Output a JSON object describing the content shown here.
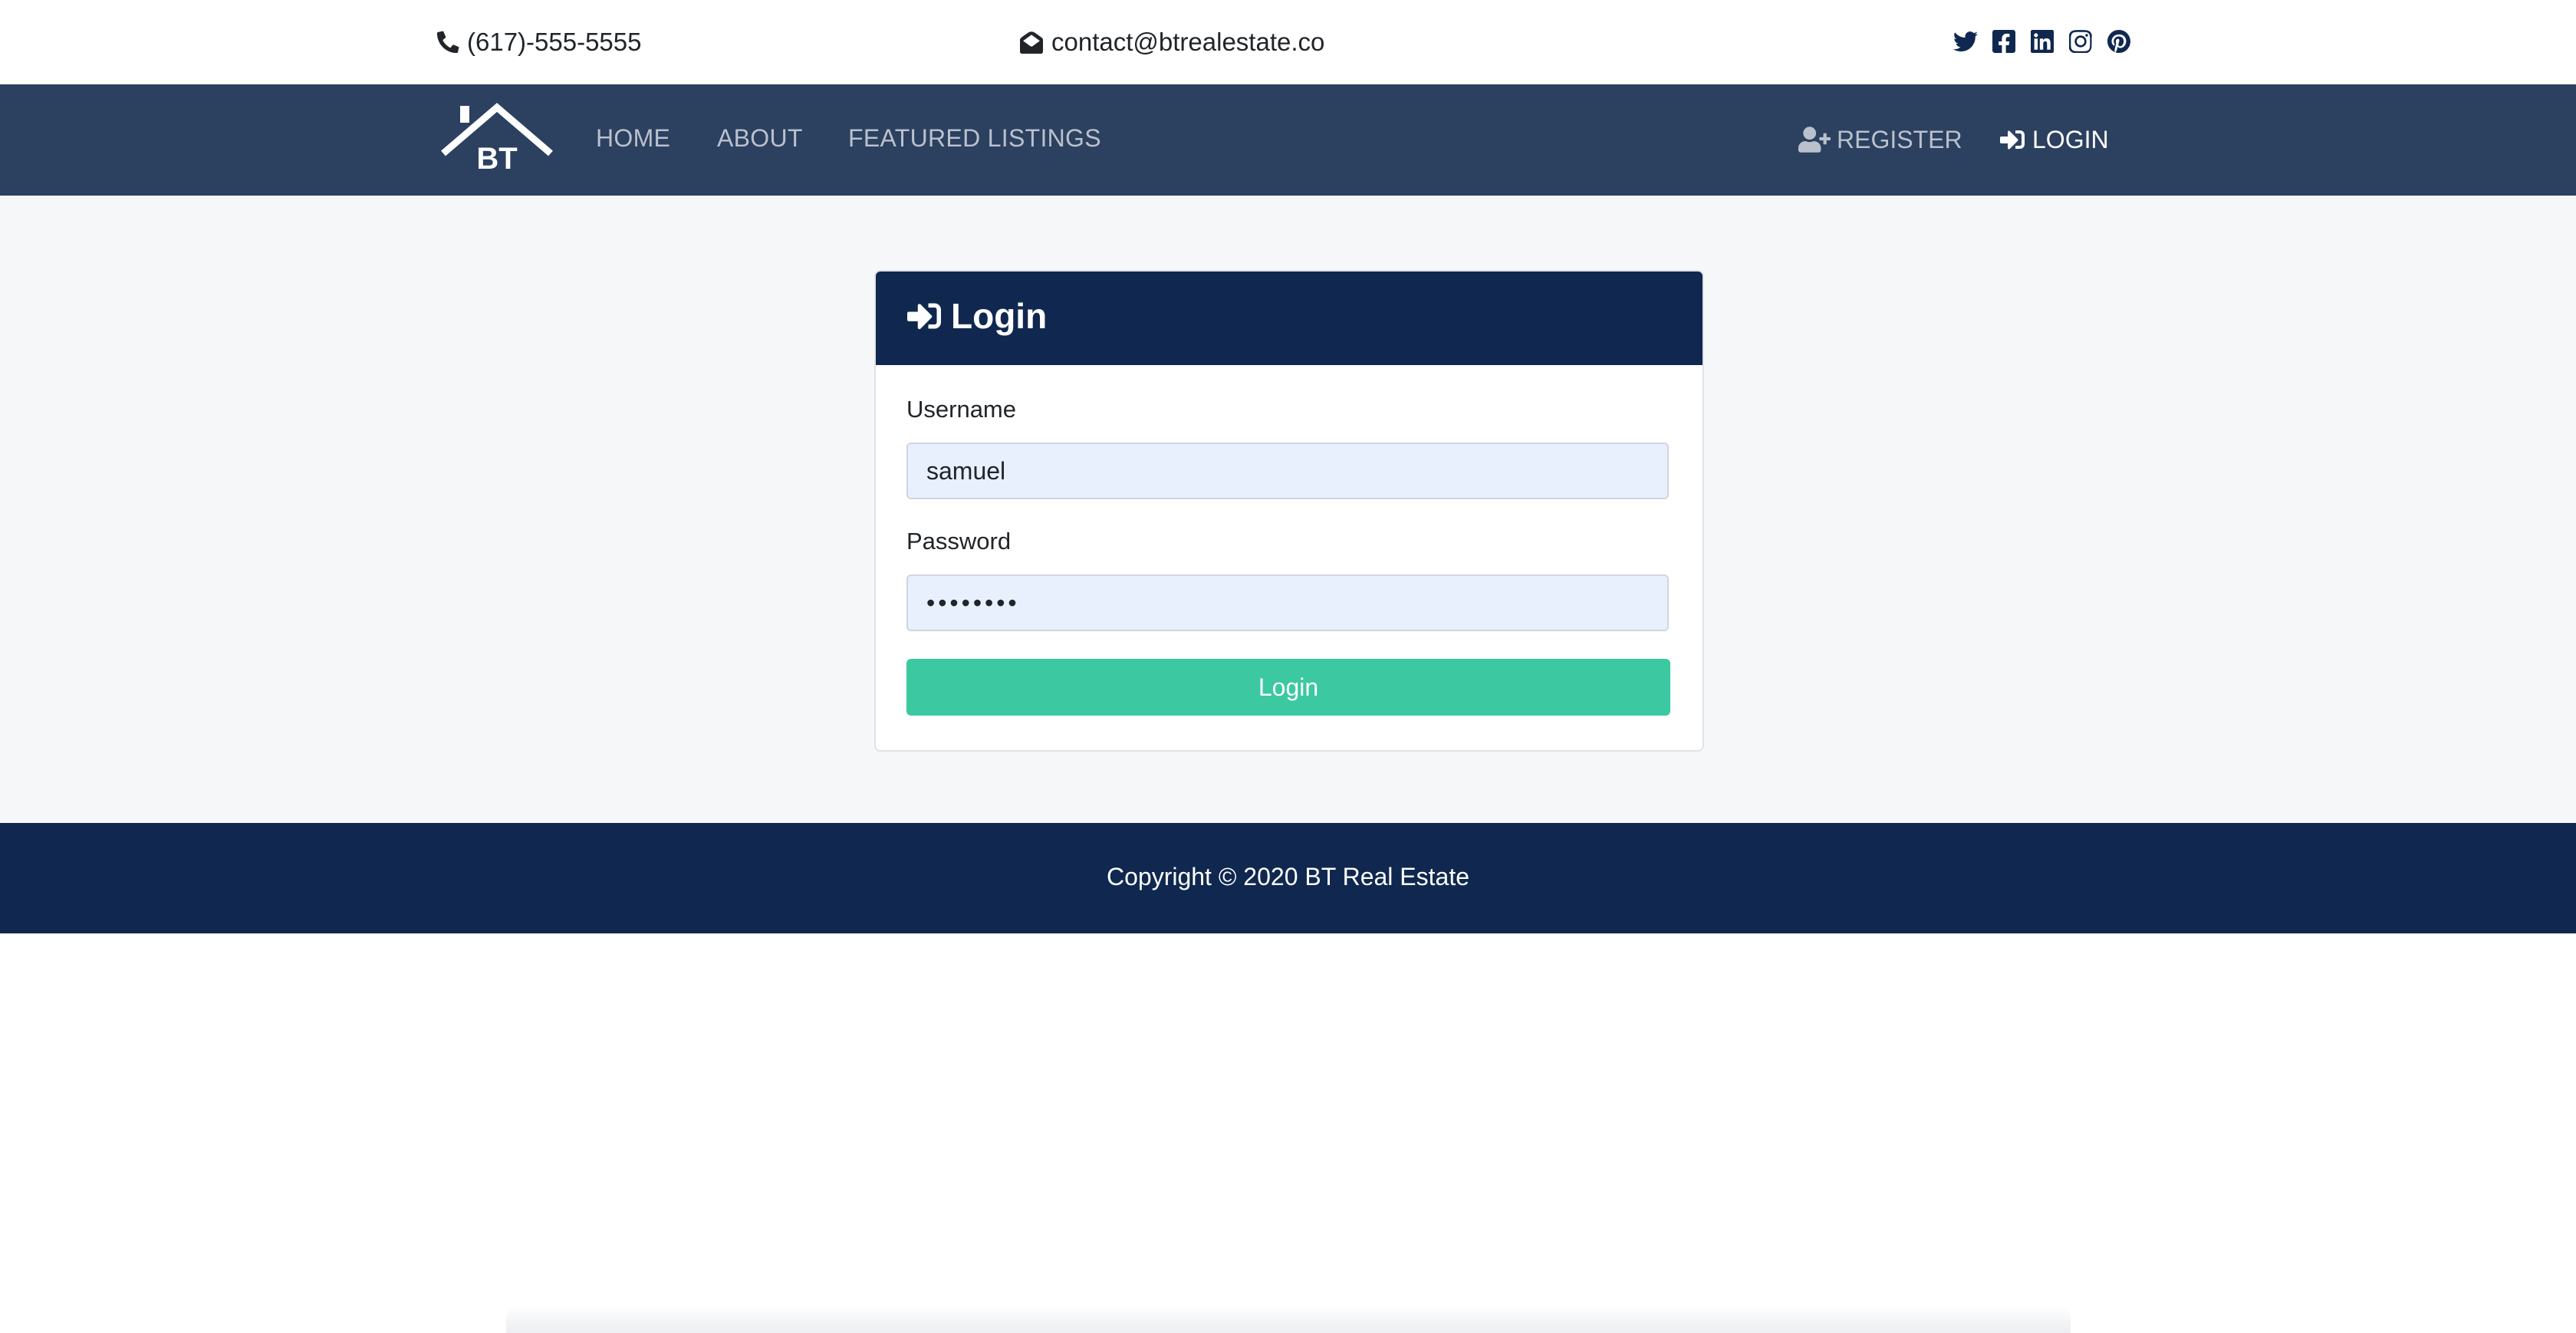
{
  "topbar": {
    "phone": "(617)-555-5555",
    "phone_icon": "phone-icon",
    "email": "contact@btrealestate.co",
    "email_icon": "envelope-open-icon",
    "social_icons": [
      "twitter-icon",
      "facebook-icon",
      "linkedin-icon",
      "instagram-icon",
      "pinterest-icon"
    ]
  },
  "navbar": {
    "logo_text": "BT",
    "links": [
      {
        "label": "HOME"
      },
      {
        "label": "ABOUT"
      },
      {
        "label": "FEATURED LISTINGS"
      }
    ],
    "register_label": "REGISTER",
    "login_label": "LOGIN"
  },
  "login_card": {
    "title": "Login",
    "username_label": "Username",
    "username_value": "samuel",
    "password_label": "Password",
    "password_value": "••••••••",
    "submit_label": "Login"
  },
  "footer": {
    "copyright": "Copyright © 2020 BT Real Estate"
  },
  "colors": {
    "topbar_bg": "#ffffff",
    "navbar_bg": "#2c4060",
    "card_header_bg": "#10284f",
    "footer_bg": "#10284f",
    "button_bg": "#3cc8a0",
    "input_bg": "#e8f0fe",
    "page_bg": "#f6f7f9"
  }
}
